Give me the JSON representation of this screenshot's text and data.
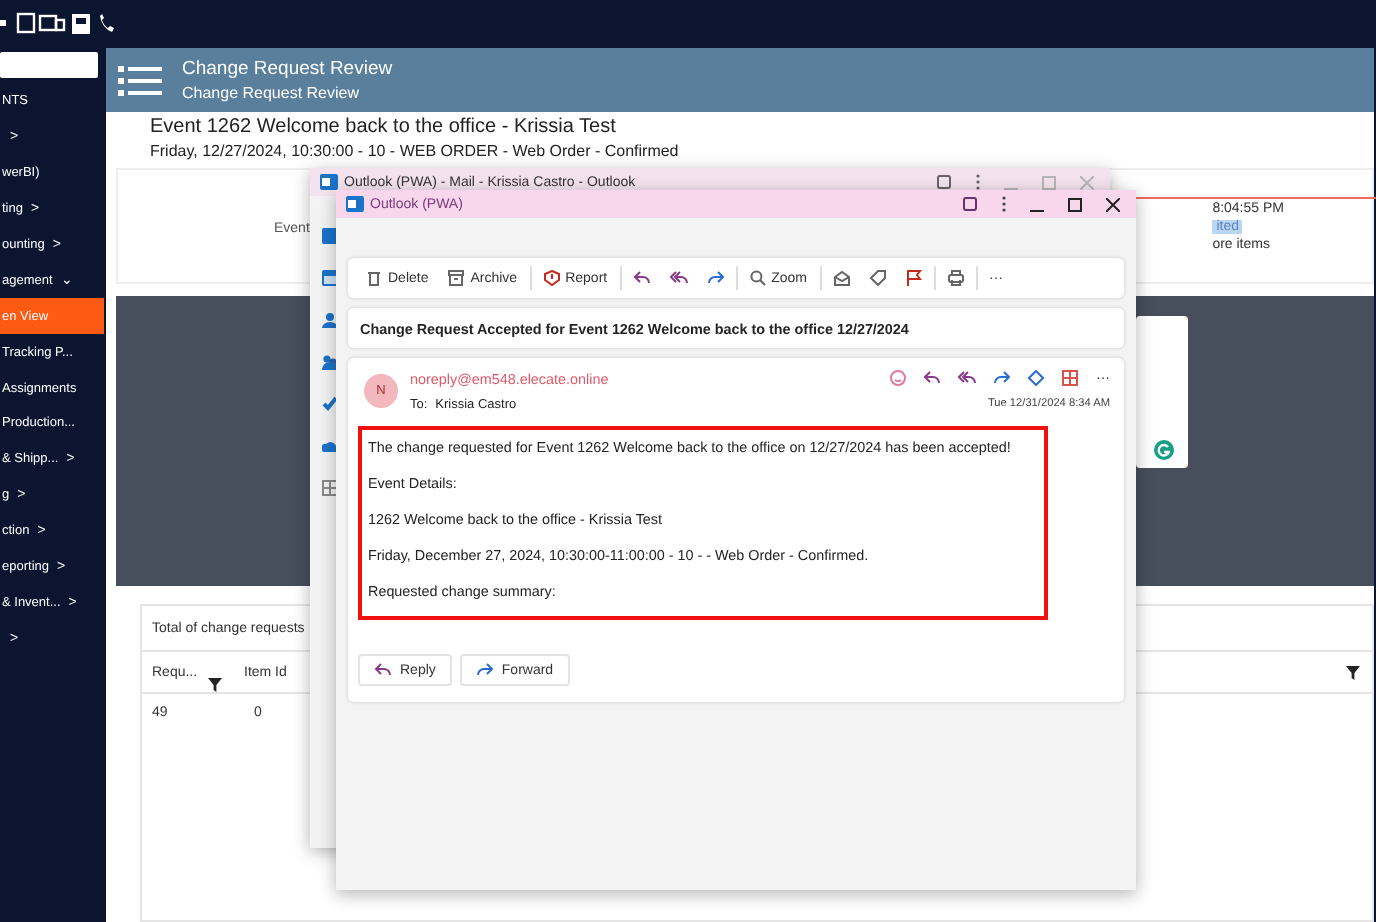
{
  "sidebar": {
    "items": [
      {
        "label": "NTS",
        "selected": false
      },
      {
        "chevron": ">",
        "selected": false
      },
      {
        "label": "werBI)",
        "selected": false
      },
      {
        "label": "ting",
        "chevron": ">",
        "selected": false
      },
      {
        "label": "ounting",
        "chevron": ">",
        "selected": false
      },
      {
        "label": "agement",
        "chevron": "⌄",
        "selected": false
      },
      {
        "label": "en View",
        "selected": true
      },
      {
        "label": "Tracking P...",
        "selected": false
      },
      {
        "label": "Assignments",
        "selected": false
      },
      {
        "label": "Production...",
        "selected": false
      },
      {
        "label": "& Shipp...",
        "chevron": ">",
        "selected": false
      },
      {
        "label": "g",
        "chevron": ">",
        "selected": false
      },
      {
        "label": "ction",
        "chevron": ">",
        "selected": false
      },
      {
        "label": "eporting",
        "chevron": ">",
        "selected": false
      },
      {
        "label": "& Invent...",
        "chevron": ">",
        "selected": false
      },
      {
        "chevron": ">",
        "selected": false
      }
    ]
  },
  "header": {
    "title": "Change Request Review",
    "subtitle": "Change Request Review"
  },
  "event": {
    "title": "Event 1262 Welcome back to the office - Krissia Test",
    "date": "Friday, 12/27/2024, 10:30:00 - 10 - WEB ORDER - Web Order - Confirmed"
  },
  "summary": {
    "label": "Event",
    "time": "8:04:55 PM",
    "status": "ited",
    "more": "ore items"
  },
  "table": {
    "caption": "Total of change requests",
    "columns": [
      "Requ...",
      "Item Id"
    ],
    "rows": [
      [
        "49",
        "0"
      ]
    ]
  },
  "outlook_back": {
    "title": "Outlook (PWA) - Mail - Krissia Castro - Outlook"
  },
  "outlook": {
    "title": "Outlook (PWA)",
    "toolbar": [
      {
        "kind": "delete",
        "label": "Delete"
      },
      {
        "kind": "archive",
        "label": "Archive"
      },
      {
        "kind": "report",
        "label": "Report"
      },
      {
        "kind": "reply"
      },
      {
        "kind": "reply-all"
      },
      {
        "kind": "forward"
      },
      {
        "kind": "zoom",
        "label": "Zoom"
      },
      {
        "kind": "read"
      },
      {
        "kind": "tag"
      },
      {
        "kind": "flag"
      },
      {
        "kind": "print"
      },
      {
        "kind": "more",
        "label": "···"
      }
    ],
    "subject": "Change Request Accepted for Event 1262 Welcome back to the office 12/27/2024",
    "message": {
      "avatar": "N",
      "sender": "noreply@em548.elecate.online",
      "to_label": "To:",
      "to": "Krissia Castro",
      "date": "Tue 12/31/2024 8:34 AM",
      "more": "···",
      "highlighted": true,
      "body": [
        "The change requested for Event 1262 Welcome back to the office on 12/27/2024 has been accepted!",
        "Event Details:",
        "1262 Welcome back to the office - Krissia Test",
        "Friday, December 27, 2024, 10:30:00-11:00:00 - 10 - - Web Order - Confirmed.",
        "Requested change summary:"
      ]
    },
    "actions": [
      {
        "kind": "reply",
        "label": "Reply"
      },
      {
        "kind": "forward",
        "label": "Forward"
      }
    ]
  }
}
